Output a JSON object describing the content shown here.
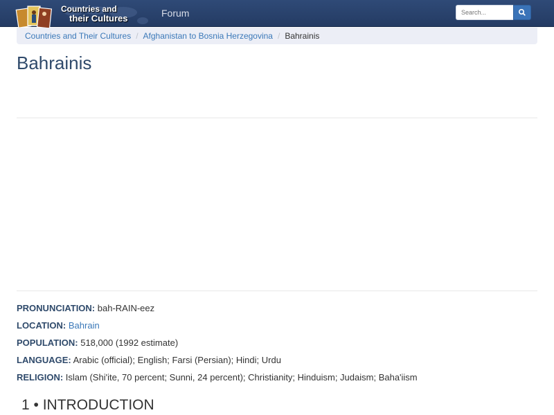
{
  "navbar": {
    "brand_line1": "Countries and",
    "brand_line2": "their Cultures",
    "forum_label": "Forum",
    "search_placeholder": "Search...",
    "search_icon": "search-icon"
  },
  "breadcrumb": {
    "items": [
      {
        "label": "Countries and Their Cultures"
      },
      {
        "label": "Afghanistan to Bosnia Herzegovina"
      },
      {
        "label": "Bahrainis"
      }
    ],
    "separator": "/"
  },
  "page": {
    "title": "Bahrainis"
  },
  "facts": [
    {
      "label": "PRONUNCIATION:",
      "value": "bah-RAIN-eez"
    },
    {
      "label": "LOCATION:",
      "value": "Bahrain"
    },
    {
      "label": "POPULATION:",
      "value": "518,000 (1992 estimate)"
    },
    {
      "label": "LANGUAGE:",
      "value": "Arabic (official); English; Farsi (Persian); Hindi; Urdu"
    },
    {
      "label": "RELIGION:",
      "value": "Islam (Shi'ite, 70 percent; Sunni, 24 percent); Christianity; Hinduism; Judaism; Baha'iism"
    }
  ],
  "section": {
    "heading": "1 • INTRODUCTION"
  },
  "colors": {
    "navbar": "#2a4370",
    "link": "#3a78b8",
    "heading": "#2f4a6b"
  }
}
